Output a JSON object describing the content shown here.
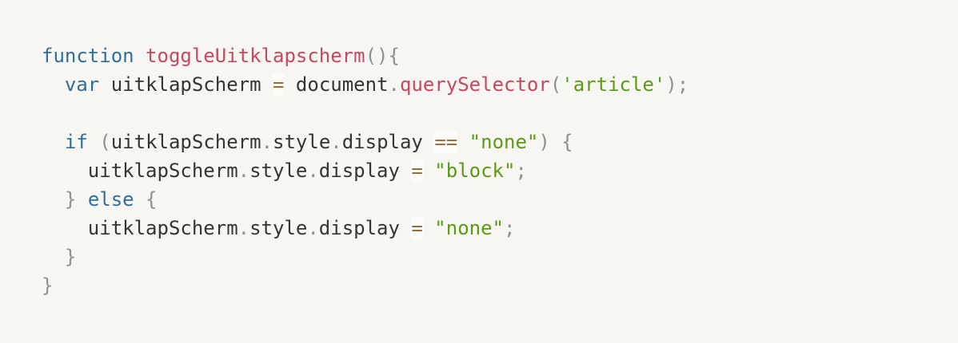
{
  "code": {
    "language": "javascript",
    "lines": [
      [
        {
          "text": "function",
          "type": "keyword"
        },
        {
          "text": " ",
          "type": "space"
        },
        {
          "text": "toggleUitklapscherm",
          "type": "function"
        },
        {
          "text": "(){",
          "type": "punct"
        }
      ],
      [
        {
          "text": "  ",
          "type": "space"
        },
        {
          "text": "var",
          "type": "keyword"
        },
        {
          "text": " uitklapScherm ",
          "type": "ident"
        },
        {
          "text": "=",
          "type": "operator"
        },
        {
          "text": " document",
          "type": "ident"
        },
        {
          "text": ".",
          "type": "punct"
        },
        {
          "text": "querySelector",
          "type": "function"
        },
        {
          "text": "(",
          "type": "punct"
        },
        {
          "text": "'article'",
          "type": "string"
        },
        {
          "text": ");",
          "type": "punct"
        }
      ],
      [],
      [
        {
          "text": "  ",
          "type": "space"
        },
        {
          "text": "if",
          "type": "keyword"
        },
        {
          "text": " (",
          "type": "punct"
        },
        {
          "text": "uitklapScherm",
          "type": "ident"
        },
        {
          "text": ".",
          "type": "punct"
        },
        {
          "text": "style",
          "type": "ident"
        },
        {
          "text": ".",
          "type": "punct"
        },
        {
          "text": "display ",
          "type": "ident"
        },
        {
          "text": "==",
          "type": "operator"
        },
        {
          "text": " ",
          "type": "space"
        },
        {
          "text": "\"none\"",
          "type": "string"
        },
        {
          "text": ") {",
          "type": "punct"
        }
      ],
      [
        {
          "text": "    ",
          "type": "space"
        },
        {
          "text": "uitklapScherm",
          "type": "ident"
        },
        {
          "text": ".",
          "type": "punct"
        },
        {
          "text": "style",
          "type": "ident"
        },
        {
          "text": ".",
          "type": "punct"
        },
        {
          "text": "display ",
          "type": "ident"
        },
        {
          "text": "=",
          "type": "operator"
        },
        {
          "text": " ",
          "type": "space"
        },
        {
          "text": "\"block\"",
          "type": "string"
        },
        {
          "text": ";",
          "type": "punct"
        }
      ],
      [
        {
          "text": "  ",
          "type": "space"
        },
        {
          "text": "}",
          "type": "punct"
        },
        {
          "text": " ",
          "type": "space"
        },
        {
          "text": "else",
          "type": "keyword"
        },
        {
          "text": " {",
          "type": "punct"
        }
      ],
      [
        {
          "text": "    ",
          "type": "space"
        },
        {
          "text": "uitklapScherm",
          "type": "ident"
        },
        {
          "text": ".",
          "type": "punct"
        },
        {
          "text": "style",
          "type": "ident"
        },
        {
          "text": ".",
          "type": "punct"
        },
        {
          "text": "display ",
          "type": "ident"
        },
        {
          "text": "=",
          "type": "operator"
        },
        {
          "text": " ",
          "type": "space"
        },
        {
          "text": "\"none\"",
          "type": "string"
        },
        {
          "text": ";",
          "type": "punct"
        }
      ],
      [
        {
          "text": "  ",
          "type": "space"
        },
        {
          "text": "}",
          "type": "punct"
        }
      ],
      [
        {
          "text": "}",
          "type": "punct"
        }
      ]
    ]
  },
  "colors": {
    "background": "#f7f6f3",
    "keyword": "#2f6f9f",
    "function": "#c8485f",
    "string": "#5c9a16",
    "punct": "#8f8f8f",
    "ident": "#37352f",
    "operator": "#9a6e3a"
  }
}
